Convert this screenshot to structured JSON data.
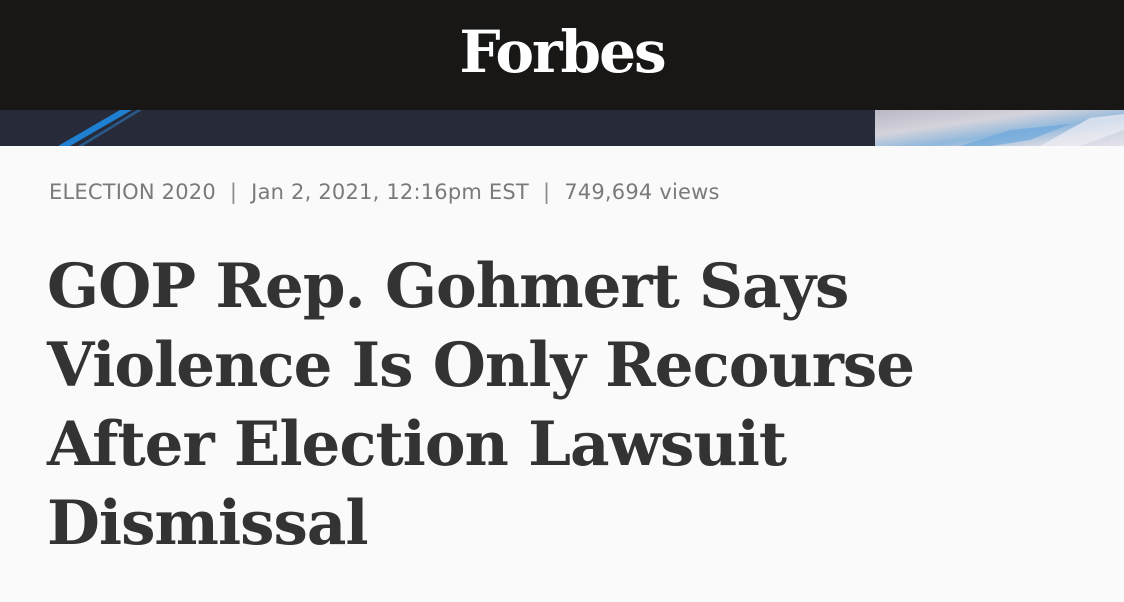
{
  "header": {
    "logo_text": "Forbes",
    "background": "#181716"
  },
  "banner": {
    "background": "#262a39"
  },
  "article": {
    "section": "ELECTION 2020",
    "separator": "|",
    "date": "Jan 2, 2021, 12:16pm EST",
    "views": "749,694 views",
    "headline": "GOP Rep. Gohmert Says Violence Is Only Recourse After Election Lawsuit Dismissal"
  }
}
